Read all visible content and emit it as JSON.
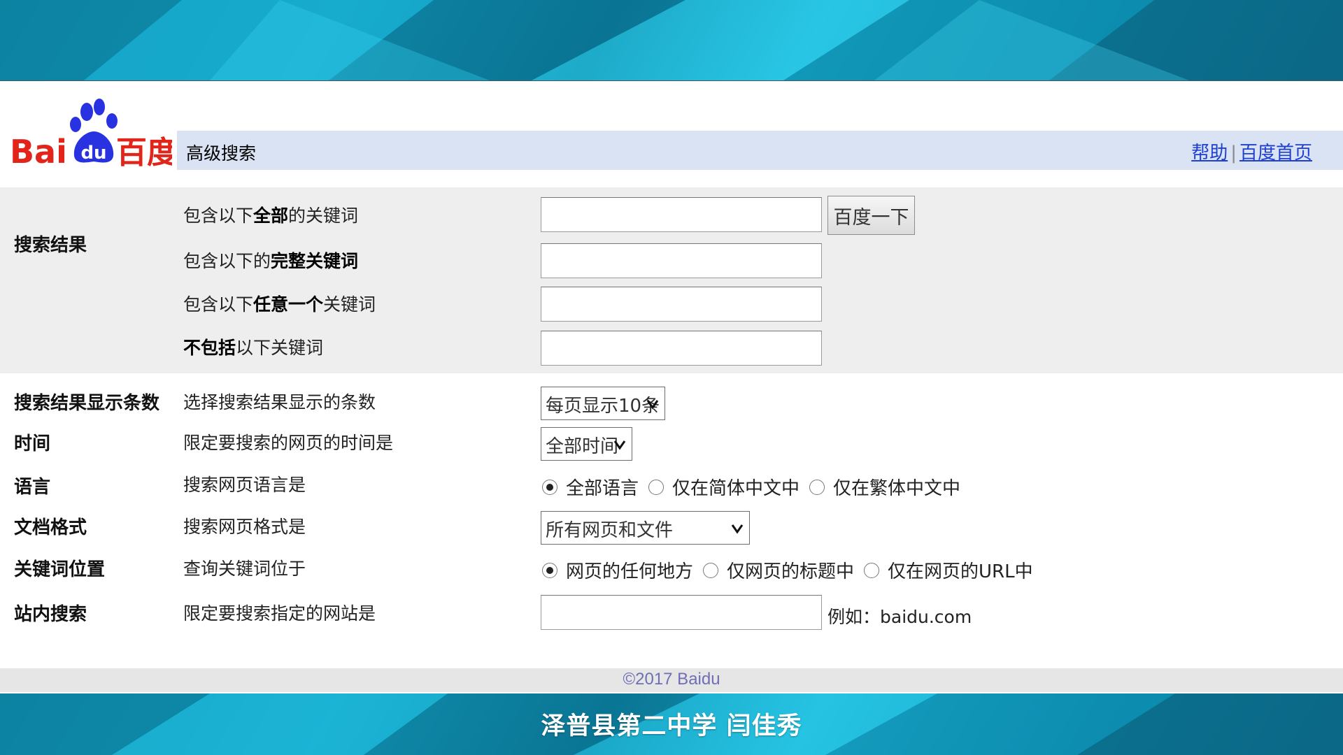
{
  "header": {
    "logo_text": "Bai du 百度",
    "title": "高级搜索",
    "links": [
      "帮助",
      "百度首页"
    ],
    "link_separator": "|"
  },
  "search_results": {
    "section_label": "搜索结果",
    "rows": [
      {
        "prefix": "包含以下",
        "bold": "全部",
        "suffix": "的关键词",
        "value": ""
      },
      {
        "prefix": "包含以下的",
        "bold": "完整关键词",
        "suffix": "",
        "value": ""
      },
      {
        "prefix": "包含以下",
        "bold": "任意一个",
        "suffix": "关键词",
        "value": ""
      },
      {
        "prefix": "",
        "bold": "不包括",
        "suffix": "以下关键词",
        "value": ""
      }
    ],
    "search_button": "百度一下"
  },
  "options": {
    "count": {
      "label": "搜索结果显示条数",
      "desc": "选择搜索结果显示的条数",
      "selected": "每页显示10条"
    },
    "time": {
      "label": "时间",
      "desc": "限定要搜索的网页的时间是",
      "selected": "全部时间"
    },
    "language": {
      "label": "语言",
      "desc": "搜索网页语言是",
      "choices": [
        "全部语言",
        "仅在简体中文中",
        "仅在繁体中文中"
      ],
      "checked_index": 0
    },
    "format": {
      "label": "文档格式",
      "desc": "搜索网页格式是",
      "selected": "所有网页和文件"
    },
    "position": {
      "label": "关键词位置",
      "desc": "查询关键词位于",
      "choices": [
        "网页的任何地方",
        "仅网页的标题中",
        "仅在网页的URL中"
      ],
      "checked_index": 0
    },
    "site": {
      "label": "站内搜索",
      "desc": "限定要搜索指定的网站是",
      "value": "",
      "example": "例如：baidu.com"
    }
  },
  "footer": {
    "copyright": "©2017 Baidu",
    "caption": "泽普县第二中学  闫佳秀"
  },
  "colors": {
    "title_bar": "#d9e3f3",
    "gray_section": "#eeeeee",
    "link": "#1f3fcf",
    "logo_red": "#e1251b",
    "logo_blue": "#2932e1",
    "banner": "#1ab4d6"
  }
}
